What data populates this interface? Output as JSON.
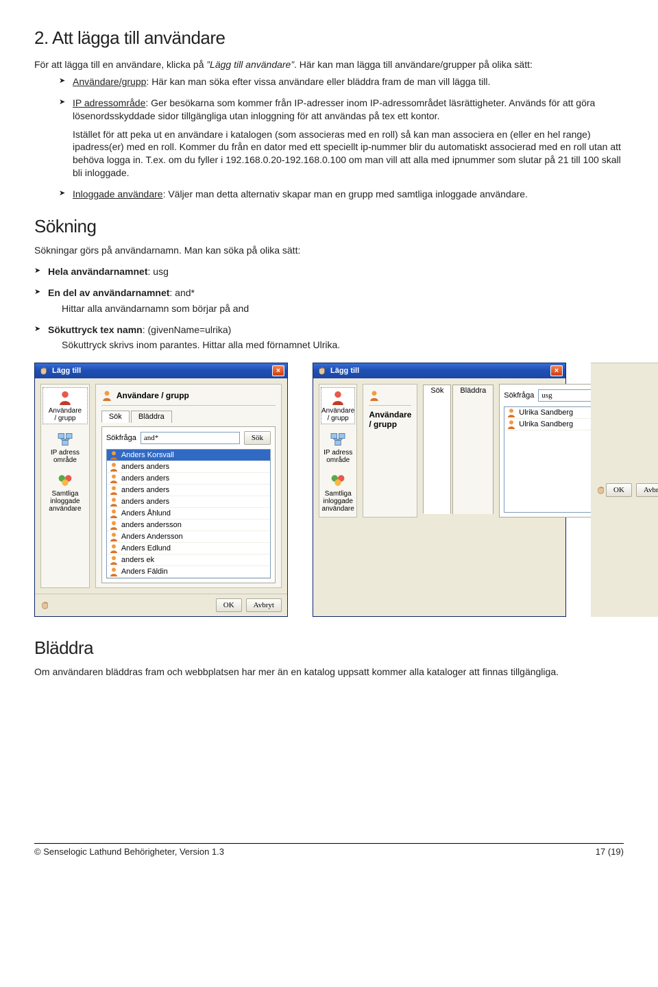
{
  "section2": {
    "heading": "2. Att lägga till användare",
    "intro_prefix": "För att lägga till en användare, klicka på ",
    "intro_quote": "”Lägg till användare”",
    "intro_suffix": ". Här kan man lägga till användare/grupper på olika sätt:",
    "items": [
      {
        "term": "Användare/grupp",
        "text": ": Här kan man söka efter vissa användare eller bläddra fram de man vill lägga till."
      },
      {
        "term": "IP adressområde",
        "text": ": Ger besökarna som kommer från IP-adresser inom IP-adressområdet läsrättigheter. Används för att göra lösenordsskyddade sidor tillgängliga utan inloggning för att användas på tex ett kontor.",
        "extra": "Istället för att peka ut en användare i katalogen (som associeras med en roll) så kan man associera en (eller en hel range) ipadress(er) med en roll. Kommer du från en dator med ett speciellt ip-nummer blir du automatiskt associerad med en roll utan att behöva logga in. T.ex. om du fyller i 192.168.0.20-192.168.0.100 om man vill att alla med ipnummer som slutar på 21 till 100 skall bli inloggade."
      },
      {
        "term": "Inloggade användare",
        "text": ": Väljer man detta alternativ skapar man en grupp med samtliga inloggade användare."
      }
    ]
  },
  "sokning": {
    "heading": "Sökning",
    "intro": "Sökningar görs på användarnamn. Man kan söka på olika sätt:",
    "items": [
      {
        "term": "Hela användarnamnet",
        "text": ": usg"
      },
      {
        "term": "En del av användarnamnet",
        "text": ": and*",
        "after": "Hittar alla användarnamn som börjar på and"
      },
      {
        "term": "Sökuttryck tex namn",
        "text": ": (givenName=ulrika)",
        "after": "Sökuttryck skrivs inom parantes. Hittar alla med förnamnet Ulrika."
      }
    ]
  },
  "dialogShared": {
    "title": "Lägg till",
    "panelTitle": "Användare / grupp",
    "tabSearch": "Sök",
    "tabBrowse": "Bläddra",
    "searchLabel": "Sökfråga",
    "searchBtn": "Sök",
    "ok": "OK",
    "cancel": "Avbryt",
    "sidebar": [
      {
        "line1": "Användare",
        "line2": "/ grupp"
      },
      {
        "line1": "IP adress",
        "line2": "område"
      },
      {
        "line1": "Samtliga",
        "line2": "inloggade",
        "line3": "användare"
      }
    ]
  },
  "dialog1": {
    "inputValue": "and*",
    "results": [
      "Anders Korsvall",
      "anders anders",
      "anders anders",
      "anders anders",
      "anders anders",
      "Anders Åhlund",
      "anders andersson",
      "Anders Andersson",
      "Anders Edlund",
      "anders ek",
      "Anders Fäldin"
    ]
  },
  "dialog2": {
    "inputValue": "usg",
    "results": [
      "Ulrika Sandberg",
      "Ulrika Sandberg"
    ]
  },
  "bladdra": {
    "heading": "Bläddra",
    "text": "Om användaren bläddras fram och webbplatsen har mer än en katalog uppsatt kommer alla kataloger att finnas tillgängliga."
  },
  "footer": {
    "left": "© Senselogic Lathund Behörigheter, Version 1.3",
    "right": "17 (19)"
  }
}
